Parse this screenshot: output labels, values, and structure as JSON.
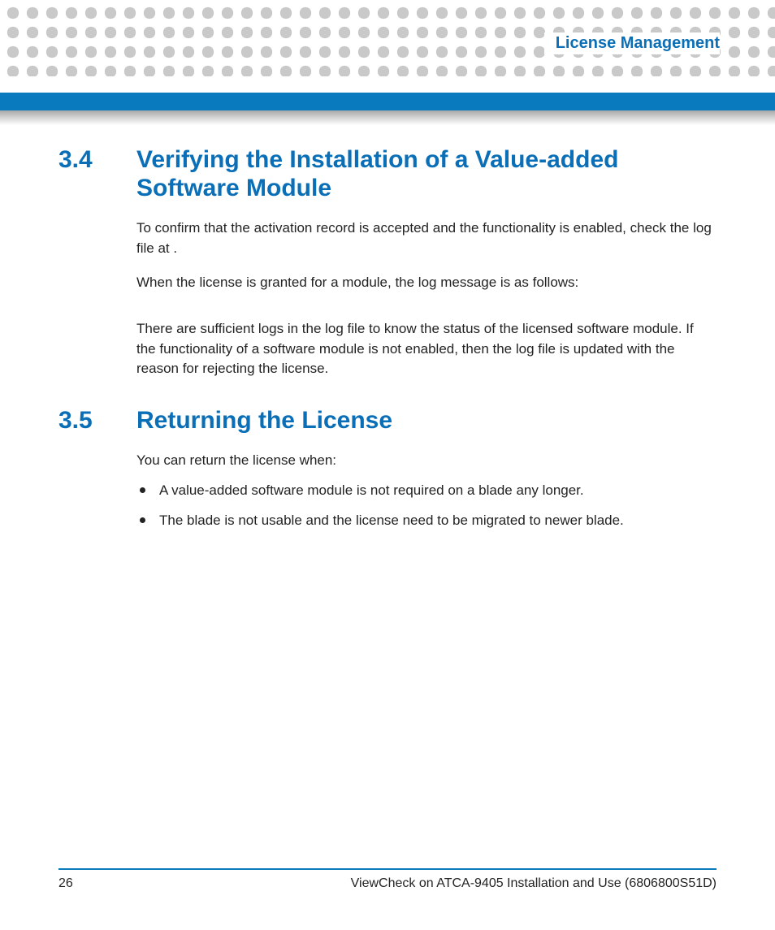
{
  "header": {
    "chapter_title": "License Management"
  },
  "sections": [
    {
      "number": "3.4",
      "title": "Verifying the Installation of a Value-added Software Module",
      "paragraphs": [
        "To confirm that the activation record is accepted and the functionality is enabled, check the log file at                                                                               .",
        "When the license is granted for a module, the log message is as follows:",
        "There are sufficient logs in the log file to know the status of the licensed software module. If the functionality of a software module is not enabled, then the log file is updated with the reason for rejecting the license."
      ]
    },
    {
      "number": "3.5",
      "title": "Returning the License",
      "intro": "You can return the license when:",
      "bullets": [
        "A value-added software module is not required on a blade any longer.",
        "The blade is not usable and the license need to be migrated to newer blade."
      ]
    }
  ],
  "footer": {
    "page_number": "26",
    "doc_title": "ViewCheck on ATCA-9405 Installation and Use (6806800S51D)"
  }
}
